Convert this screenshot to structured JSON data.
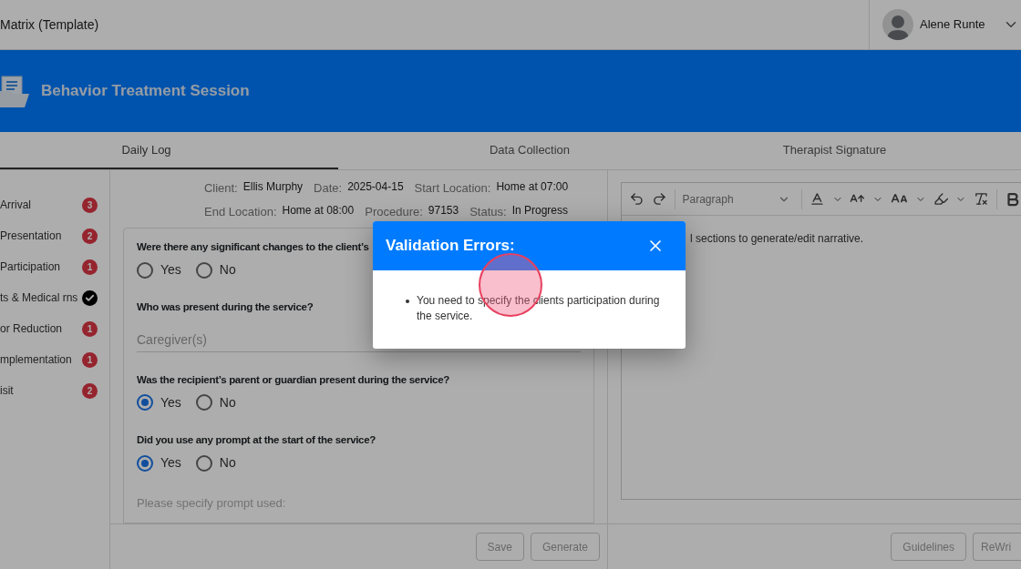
{
  "header": {
    "title": "Matrix (Template)",
    "user": {
      "name": "Alene Runte"
    }
  },
  "banner": {
    "title": "Behavior Treatment Session"
  },
  "tabs": [
    {
      "label": "Daily Log",
      "selected": true
    },
    {
      "label": "Data Collection",
      "selected": false
    },
    {
      "label": "Therapist Signature",
      "selected": false
    }
  ],
  "sidebar": {
    "items": [
      {
        "label": "Arrival",
        "status": {
          "kind": "count",
          "text": "3"
        }
      },
      {
        "label": "Presentation",
        "status": {
          "kind": "count",
          "text": "2"
        }
      },
      {
        "label": "Participation",
        "status": {
          "kind": "count",
          "text": "1"
        }
      },
      {
        "label": "ts & Medical rns",
        "status": {
          "kind": "check"
        }
      },
      {
        "label": "or Reduction",
        "status": {
          "kind": "count",
          "text": "1"
        }
      },
      {
        "label": "mplementation",
        "status": {
          "kind": "count",
          "text": "1"
        }
      },
      {
        "label": "isit",
        "status": {
          "kind": "count",
          "text": "2"
        }
      }
    ]
  },
  "session_info": [
    [
      {
        "label": "Client:",
        "value": "Ellis Murphy"
      },
      {
        "label": "Date:",
        "value": "2025-04-15"
      },
      {
        "label": "Start Location:",
        "value": "Home at 07:00"
      }
    ],
    [
      {
        "label": "End Location:",
        "value": "Home at 08:00"
      },
      {
        "label": "Procedure:",
        "value": "97153"
      },
      {
        "label": "Status:",
        "value": "In Progress"
      }
    ]
  ],
  "form": {
    "questions": [
      {
        "kind": "radio",
        "text": "Were there any significant changes to the client’s",
        "options": [
          {
            "label": "Yes",
            "selected": false
          },
          {
            "label": "No",
            "selected": false
          }
        ]
      },
      {
        "kind": "text",
        "text": "Who was present during the service?",
        "placeholder": "Caregiver(s)"
      },
      {
        "kind": "radio",
        "text": "Was the recipient’s parent or guardian present during the service?",
        "options": [
          {
            "label": "Yes",
            "selected": true
          },
          {
            "label": "No",
            "selected": false
          }
        ]
      },
      {
        "kind": "radio",
        "text": "Did you use any prompt at the start of the service?",
        "options": [
          {
            "label": "Yes",
            "selected": true
          },
          {
            "label": "No",
            "selected": false
          }
        ]
      },
      {
        "kind": "field",
        "placeholder": "Please specify prompt used:"
      }
    ]
  },
  "form_actions": [
    {
      "label": "Save",
      "disabled": true
    },
    {
      "label": "Generate",
      "disabled": true
    }
  ],
  "editor": {
    "block_format": "Paragraph",
    "content": "l sections to generate/edit narrative."
  },
  "editor_actions": [
    {
      "label": "Guidelines",
      "disabled": true
    },
    {
      "label": "ReWri",
      "disabled": true
    }
  ],
  "dialog": {
    "title": "Validation Errors:",
    "errors": [
      "You need to specify the clients participation during the service."
    ]
  }
}
